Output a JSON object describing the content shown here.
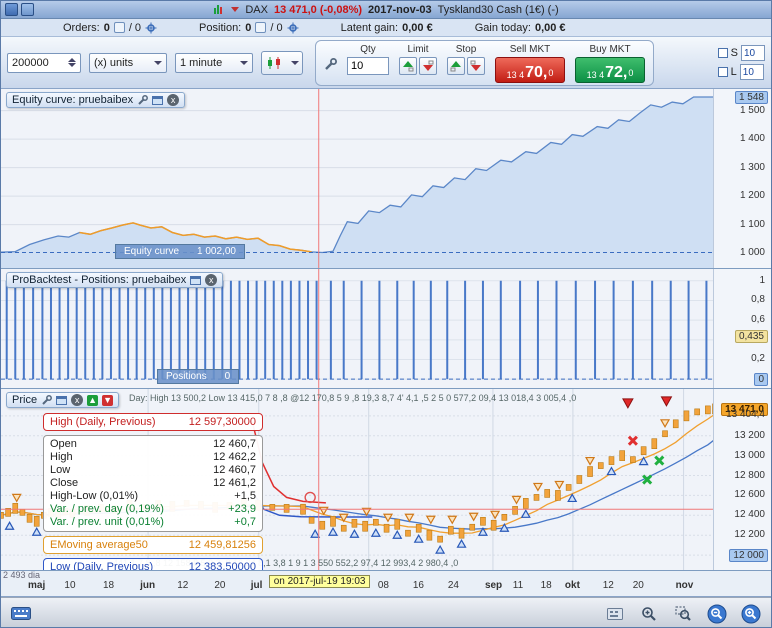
{
  "titlebar": {
    "instrument": "DAX",
    "price": "13 471,0 (-0,08%)",
    "date": "2017-nov-03",
    "market": "Tyskland30 Cash (1€) (-)"
  },
  "status": {
    "orders_label": "Orders:",
    "orders_value": "0",
    "orders_slash": "/ 0",
    "position_label": "Position:",
    "position_value": "0",
    "position_slash": "/ 0",
    "latent_label": "Latent gain:",
    "latent_value": "0,00 €",
    "gain_label": "Gain today:",
    "gain_value": "0,00 €"
  },
  "toolbar": {
    "amount_value": "200000",
    "units_label": "(x) units",
    "timeframe_label": "1 minute"
  },
  "trade": {
    "qty_label": "Qty",
    "qty_value": "10",
    "limit_label": "Limit",
    "stop_label": "Stop",
    "sell_label": "Sell MKT",
    "sell_prefix": "13 4",
    "sell_main": "70,",
    "sell_sup": "0",
    "buy_label": "Buy MKT",
    "buy_prefix": "13 4",
    "buy_main": "72,",
    "buy_sup": "0",
    "s_label": "S",
    "s_value": "10",
    "l_label": "L",
    "l_value": "10"
  },
  "equity_panel": {
    "title": "Equity curve: pruebaibex",
    "label": "Equity curve",
    "value": "1 002,00",
    "axis": [
      {
        "v": 1548,
        "label": "1 548",
        "hl": "blue"
      },
      {
        "v": 1500,
        "label": "1 500"
      },
      {
        "v": 1400,
        "label": "1 400"
      },
      {
        "v": 1300,
        "label": "1 300"
      },
      {
        "v": 1200,
        "label": "1 200"
      },
      {
        "v": 1100,
        "label": "1 100"
      },
      {
        "v": 1000,
        "label": "1 000"
      }
    ]
  },
  "positions_panel": {
    "title": "ProBacktest - Positions: pruebaibex",
    "label": "Positions",
    "value": "0",
    "axis": [
      {
        "v": 1,
        "label": "1"
      },
      {
        "v": 0.8,
        "label": "0,8"
      },
      {
        "v": 0.6,
        "label": "0,6"
      },
      {
        "v": 0.435,
        "label": "0,435",
        "hl": "yellow"
      },
      {
        "v": 0.2,
        "label": "0,2"
      },
      {
        "v": 0,
        "label": "0",
        "hl": "blue"
      }
    ]
  },
  "price_panel": {
    "title": "Price",
    "overlay_top": "Day: High 13 500,2  Low 13 415,0    7 8 ,8 @12 170,8 5 9 ,8      19,3 8,7 4' 4,1 ,5 2 5 0    577,2 09,4    13 018,4    3 005,4 ,0",
    "overlay_bottom": "441,1    7 8 ,8    12 158,8 5 9 3 ,8    16  24    8,1 3,8 1 9 1 3 550    552,2 97,4    12 993,4    2 980,4 ,0",
    "tooltip": {
      "high_label": "High (Daily, Previous)",
      "high_value": "12 597,30000",
      "rows": [
        {
          "label": "Open",
          "value": "12 460,7"
        },
        {
          "label": "High",
          "value": "12 462,2"
        },
        {
          "label": "Low",
          "value": "12 460,7"
        },
        {
          "label": "Close",
          "value": "12 461,2"
        },
        {
          "label": "High-Low (0,01%)",
          "value": "+1,5"
        },
        {
          "label": "Var. / prev. day (0,19%)",
          "value": "+23,9",
          "color": "green"
        },
        {
          "label": "Var. / prev. unit (0,01%)",
          "value": "+0,7",
          "color": "green"
        }
      ],
      "ema_label": "EMoving average50",
      "ema_value": "12 459,81256",
      "low_label": "Low (Daily, Previous)",
      "low_value": "12 383,50000"
    },
    "axis": [
      {
        "v": 13471,
        "label": "13 471,0",
        "hl": "orange"
      },
      {
        "v": 13404.4,
        "label": "13 404,4"
      },
      {
        "v": 13200,
        "label": "13 200"
      },
      {
        "v": 13000,
        "label": "13 000"
      },
      {
        "v": 12800,
        "label": "12 800"
      },
      {
        "v": 12600,
        "label": "12 600"
      },
      {
        "v": 12400,
        "label": "12 400"
      },
      {
        "v": 12200,
        "label": "12 200"
      },
      {
        "v": 12000,
        "label": "12 000",
        "hl": "blue"
      }
    ]
  },
  "xaxis": {
    "count_label": "2 493 dia",
    "cursor_date": "on 2017-jul-19 19:03",
    "ticks": [
      {
        "f": 0.049,
        "label": "maj",
        "month": true
      },
      {
        "f": 0.1,
        "label": "10"
      },
      {
        "f": 0.154,
        "label": "18"
      },
      {
        "f": 0.206,
        "label": "jun",
        "month": true
      },
      {
        "f": 0.258,
        "label": "12"
      },
      {
        "f": 0.31,
        "label": "20"
      },
      {
        "f": 0.361,
        "label": "jul",
        "month": true
      },
      {
        "f": 0.539,
        "label": "08"
      },
      {
        "f": 0.588,
        "label": "16"
      },
      {
        "f": 0.637,
        "label": "24"
      },
      {
        "f": 0.689,
        "label": "sep",
        "month": true
      },
      {
        "f": 0.728,
        "label": "11"
      },
      {
        "f": 0.767,
        "label": "18"
      },
      {
        "f": 0.801,
        "label": "okt",
        "month": true
      },
      {
        "f": 0.854,
        "label": "12"
      },
      {
        "f": 0.896,
        "label": "20"
      },
      {
        "f": 0.956,
        "label": "nov",
        "month": true
      }
    ]
  },
  "charts": {
    "crosshair_frac": 0.445,
    "equity": {
      "vmin": 944,
      "vmax": 1576,
      "current": 1002,
      "grid": [
        1000,
        1100,
        1200,
        1300,
        1400,
        1500
      ],
      "orange_range": [
        0.1,
        0.445
      ],
      "points": [
        [
          0,
          1003
        ],
        [
          0.02,
          1005
        ],
        [
          0.04,
          1030
        ],
        [
          0.06,
          1046
        ],
        [
          0.08,
          1060
        ],
        [
          0.095,
          1056
        ],
        [
          0.11,
          1072
        ],
        [
          0.125,
          1066
        ],
        [
          0.14,
          1079
        ],
        [
          0.155,
          1088
        ],
        [
          0.17,
          1098
        ],
        [
          0.185,
          1106
        ],
        [
          0.195,
          1098
        ],
        [
          0.21,
          1088
        ],
        [
          0.225,
          1092
        ],
        [
          0.24,
          1072
        ],
        [
          0.255,
          1062
        ],
        [
          0.27,
          1066
        ],
        [
          0.285,
          1056
        ],
        [
          0.3,
          1060
        ],
        [
          0.315,
          1050
        ],
        [
          0.33,
          1056
        ],
        [
          0.345,
          1048
        ],
        [
          0.36,
          1052
        ],
        [
          0.375,
          1030
        ],
        [
          0.39,
          1026
        ],
        [
          0.405,
          1014
        ],
        [
          0.42,
          1010
        ],
        [
          0.435,
          1004
        ],
        [
          0.45,
          1002
        ],
        [
          0.465,
          1006
        ],
        [
          0.475,
          1060
        ],
        [
          0.485,
          1110
        ],
        [
          0.5,
          1104
        ],
        [
          0.515,
          1148
        ],
        [
          0.53,
          1142
        ],
        [
          0.545,
          1168
        ],
        [
          0.56,
          1162
        ],
        [
          0.575,
          1204
        ],
        [
          0.59,
          1198
        ],
        [
          0.605,
          1236
        ],
        [
          0.62,
          1230
        ],
        [
          0.635,
          1264
        ],
        [
          0.65,
          1258
        ],
        [
          0.665,
          1296
        ],
        [
          0.68,
          1290
        ],
        [
          0.7,
          1326
        ],
        [
          0.715,
          1320
        ],
        [
          0.735,
          1356
        ],
        [
          0.75,
          1350
        ],
        [
          0.77,
          1388
        ],
        [
          0.785,
          1382
        ],
        [
          0.8,
          1416
        ],
        [
          0.815,
          1410
        ],
        [
          0.835,
          1444
        ],
        [
          0.85,
          1438
        ],
        [
          0.865,
          1468
        ],
        [
          0.88,
          1462
        ],
        [
          0.895,
          1492
        ],
        [
          0.91,
          1520
        ],
        [
          0.925,
          1512
        ],
        [
          0.94,
          1530
        ],
        [
          0.955,
          1524
        ],
        [
          0.97,
          1548
        ],
        [
          1,
          1548
        ]
      ]
    },
    "positions": {
      "vmin": -0.1,
      "vmax": 1.12,
      "grid": [
        0,
        0.2,
        0.4,
        0.6,
        0.8,
        1
      ],
      "spikes": [
        0.008,
        0.02,
        0.032,
        0.045,
        0.058,
        0.07,
        0.082,
        0.094,
        0.106,
        0.118,
        0.13,
        0.142,
        0.154,
        0.166,
        0.178,
        0.19,
        0.202,
        0.214,
        0.226,
        0.238,
        0.25,
        0.262,
        0.274,
        0.286,
        0.298,
        0.31,
        0.322,
        0.334,
        0.346,
        0.358,
        0.37,
        0.382,
        0.394,
        0.406,
        0.418,
        0.43,
        0.442,
        0.462,
        0.48,
        0.505,
        0.53,
        0.555,
        0.578,
        0.602,
        0.625,
        0.65,
        0.675,
        0.7,
        0.727,
        0.752,
        0.778,
        0.805,
        0.832,
        0.858,
        0.885,
        0.912,
        0.938,
        0.963,
        0.988
      ]
    },
    "price": {
      "vmin": 11840,
      "vmax": 13670,
      "crosshair_value": 12461,
      "grid": [
        12000,
        12200,
        12400,
        12600,
        12800,
        13000,
        13200,
        13400
      ],
      "month_lines": [
        0.206,
        0.361,
        0.515,
        0.689,
        0.801,
        0.956
      ],
      "series": [
        [
          0,
          12400
        ],
        [
          0.01,
          12430
        ],
        [
          0.02,
          12470
        ],
        [
          0.03,
          12430
        ],
        [
          0.04,
          12370
        ],
        [
          0.05,
          12340
        ],
        [
          0.06,
          12400
        ],
        [
          0.07,
          12430
        ],
        [
          0.08,
          12410
        ],
        [
          0.09,
          12440
        ],
        [
          0.1,
          12420
        ],
        [
          0.12,
          12450
        ],
        [
          0.14,
          12480
        ],
        [
          0.16,
          12460
        ],
        [
          0.18,
          12500
        ],
        [
          0.2,
          12480
        ],
        [
          0.22,
          12510
        ],
        [
          0.24,
          12490
        ],
        [
          0.26,
          12520
        ],
        [
          0.28,
          12500
        ],
        [
          0.3,
          12480
        ],
        [
          0.32,
          12500
        ],
        [
          0.34,
          12520
        ],
        [
          0.36,
          12500
        ],
        [
          0.38,
          12480
        ],
        [
          0.4,
          12470
        ],
        [
          0.423,
          12461
        ],
        [
          0.435,
          12350
        ],
        [
          0.45,
          12300
        ],
        [
          0.465,
          12340
        ],
        [
          0.48,
          12270
        ],
        [
          0.495,
          12320
        ],
        [
          0.51,
          12290
        ],
        [
          0.525,
          12330
        ],
        [
          0.54,
          12270
        ],
        [
          0.555,
          12310
        ],
        [
          0.57,
          12220
        ],
        [
          0.585,
          12270
        ],
        [
          0.6,
          12200
        ],
        [
          0.615,
          12160
        ],
        [
          0.63,
          12250
        ],
        [
          0.645,
          12220
        ],
        [
          0.66,
          12280
        ],
        [
          0.675,
          12340
        ],
        [
          0.69,
          12300
        ],
        [
          0.705,
          12380
        ],
        [
          0.72,
          12450
        ],
        [
          0.735,
          12520
        ],
        [
          0.75,
          12580
        ],
        [
          0.765,
          12620
        ],
        [
          0.78,
          12600
        ],
        [
          0.795,
          12680
        ],
        [
          0.81,
          12760
        ],
        [
          0.825,
          12840
        ],
        [
          0.84,
          12900
        ],
        [
          0.855,
          12950
        ],
        [
          0.87,
          13000
        ],
        [
          0.885,
          12960
        ],
        [
          0.9,
          13050
        ],
        [
          0.915,
          13120
        ],
        [
          0.93,
          13220
        ],
        [
          0.945,
          13320
        ],
        [
          0.96,
          13400
        ],
        [
          0.975,
          13440
        ],
        [
          0.99,
          13460
        ],
        [
          1,
          13470
        ]
      ],
      "daily_high_line": {
        "color": "#e03030",
        "points": [
          [
            0.352,
            13340
          ],
          [
            0.366,
            12930
          ],
          [
            0.382,
            12690
          ],
          [
            0.4,
            12580
          ],
          [
            0.423,
            12540
          ],
          [
            0.455,
            12525
          ]
        ]
      },
      "daily_low_line": {
        "color": "#3058c8",
        "points": [
          [
            0.352,
            12640
          ],
          [
            0.368,
            12460
          ],
          [
            0.39,
            12400
          ],
          [
            0.42,
            12386
          ],
          [
            0.47,
            12383
          ],
          [
            0.52,
            12383
          ]
        ]
      },
      "markers": {
        "up": [
          [
            0.012,
            12330
          ],
          [
            0.05,
            12270
          ],
          [
            0.44,
            12250
          ],
          [
            0.465,
            12270
          ],
          [
            0.495,
            12250
          ],
          [
            0.525,
            12260
          ],
          [
            0.555,
            12240
          ],
          [
            0.585,
            12200
          ],
          [
            0.615,
            12090
          ],
          [
            0.645,
            12150
          ],
          [
            0.675,
            12270
          ],
          [
            0.705,
            12310
          ],
          [
            0.735,
            12450
          ],
          [
            0.8,
            12610
          ],
          [
            0.855,
            12880
          ],
          [
            0.9,
            12980
          ]
        ],
        "down": [
          [
            0.022,
            12540
          ],
          [
            0.452,
            12410
          ],
          [
            0.48,
            12340
          ],
          [
            0.512,
            12400
          ],
          [
            0.542,
            12340
          ],
          [
            0.572,
            12340
          ],
          [
            0.602,
            12320
          ],
          [
            0.632,
            12320
          ],
          [
            0.662,
            12350
          ],
          [
            0.692,
            12370
          ],
          [
            0.722,
            12520
          ],
          [
            0.752,
            12650
          ],
          [
            0.782,
            12670
          ],
          [
            0.825,
            12910
          ],
          [
            0.93,
            13290
          ]
        ],
        "red_down": [
          [
            0.878,
            13480
          ],
          [
            0.932,
            13500
          ]
        ],
        "red_x": [
          [
            0.885,
            13150
          ]
        ],
        "green_x": [
          [
            0.905,
            12760
          ],
          [
            0.922,
            12950
          ]
        ],
        "circle": [
          [
            0.433,
            12580
          ]
        ]
      }
    }
  }
}
